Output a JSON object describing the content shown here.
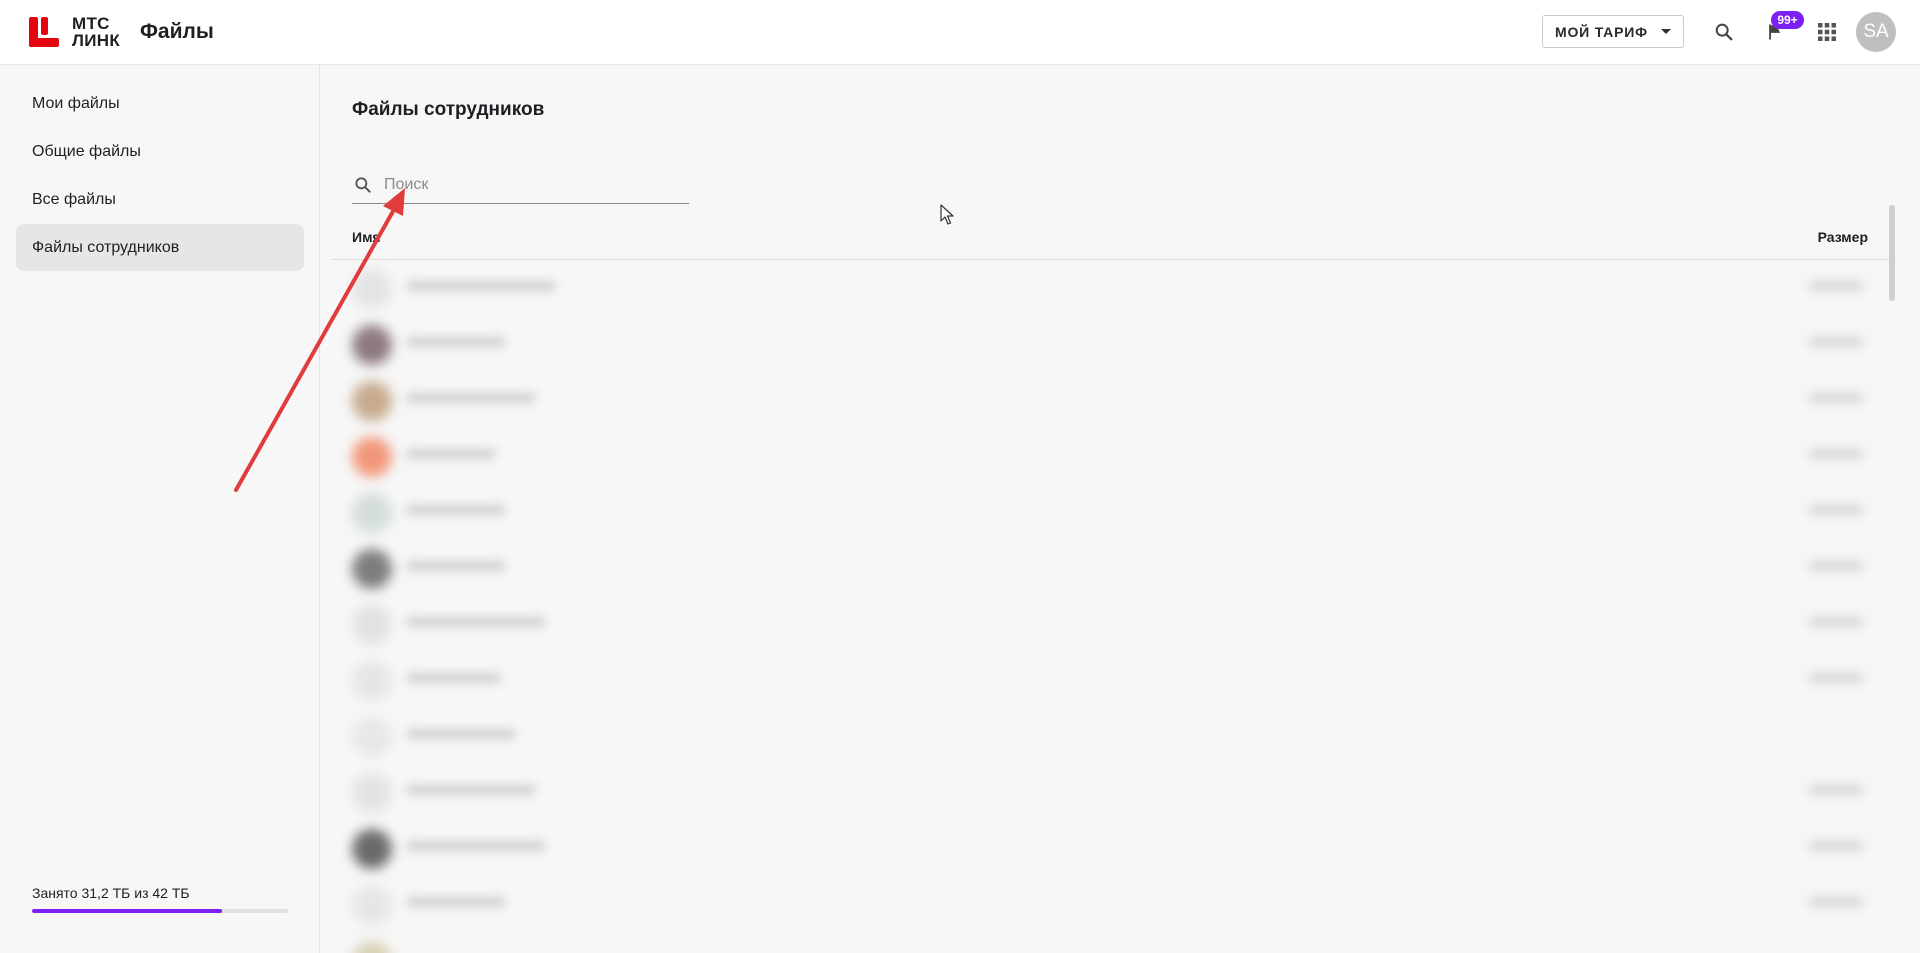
{
  "header": {
    "brand_line1": "МТС",
    "brand_line2": "ЛИНК",
    "app_title": "Файлы",
    "tariff_label": "МОЙ ТАРИФ",
    "notification_badge": "99+",
    "avatar_initials": "SA",
    "brand_color": "#e30611",
    "accent_color": "#7c1ff2"
  },
  "sidebar": {
    "items": [
      {
        "label": "Мои файлы",
        "active": false
      },
      {
        "label": "Общие файлы",
        "active": false
      },
      {
        "label": "Все файлы",
        "active": false
      },
      {
        "label": "Файлы сотрудников",
        "active": true
      }
    ],
    "storage": {
      "text": "Занято 31,2 ТБ из 42 ТБ",
      "used_fraction": 0.743
    }
  },
  "main": {
    "title": "Файлы сотрудников",
    "search": {
      "placeholder": "Поиск",
      "value": ""
    },
    "table": {
      "columns": {
        "name": "Имя",
        "size": "Размер"
      }
    }
  },
  "annotation": {
    "type": "arrow",
    "color": "#e03c3c",
    "points_to": "search-input"
  }
}
